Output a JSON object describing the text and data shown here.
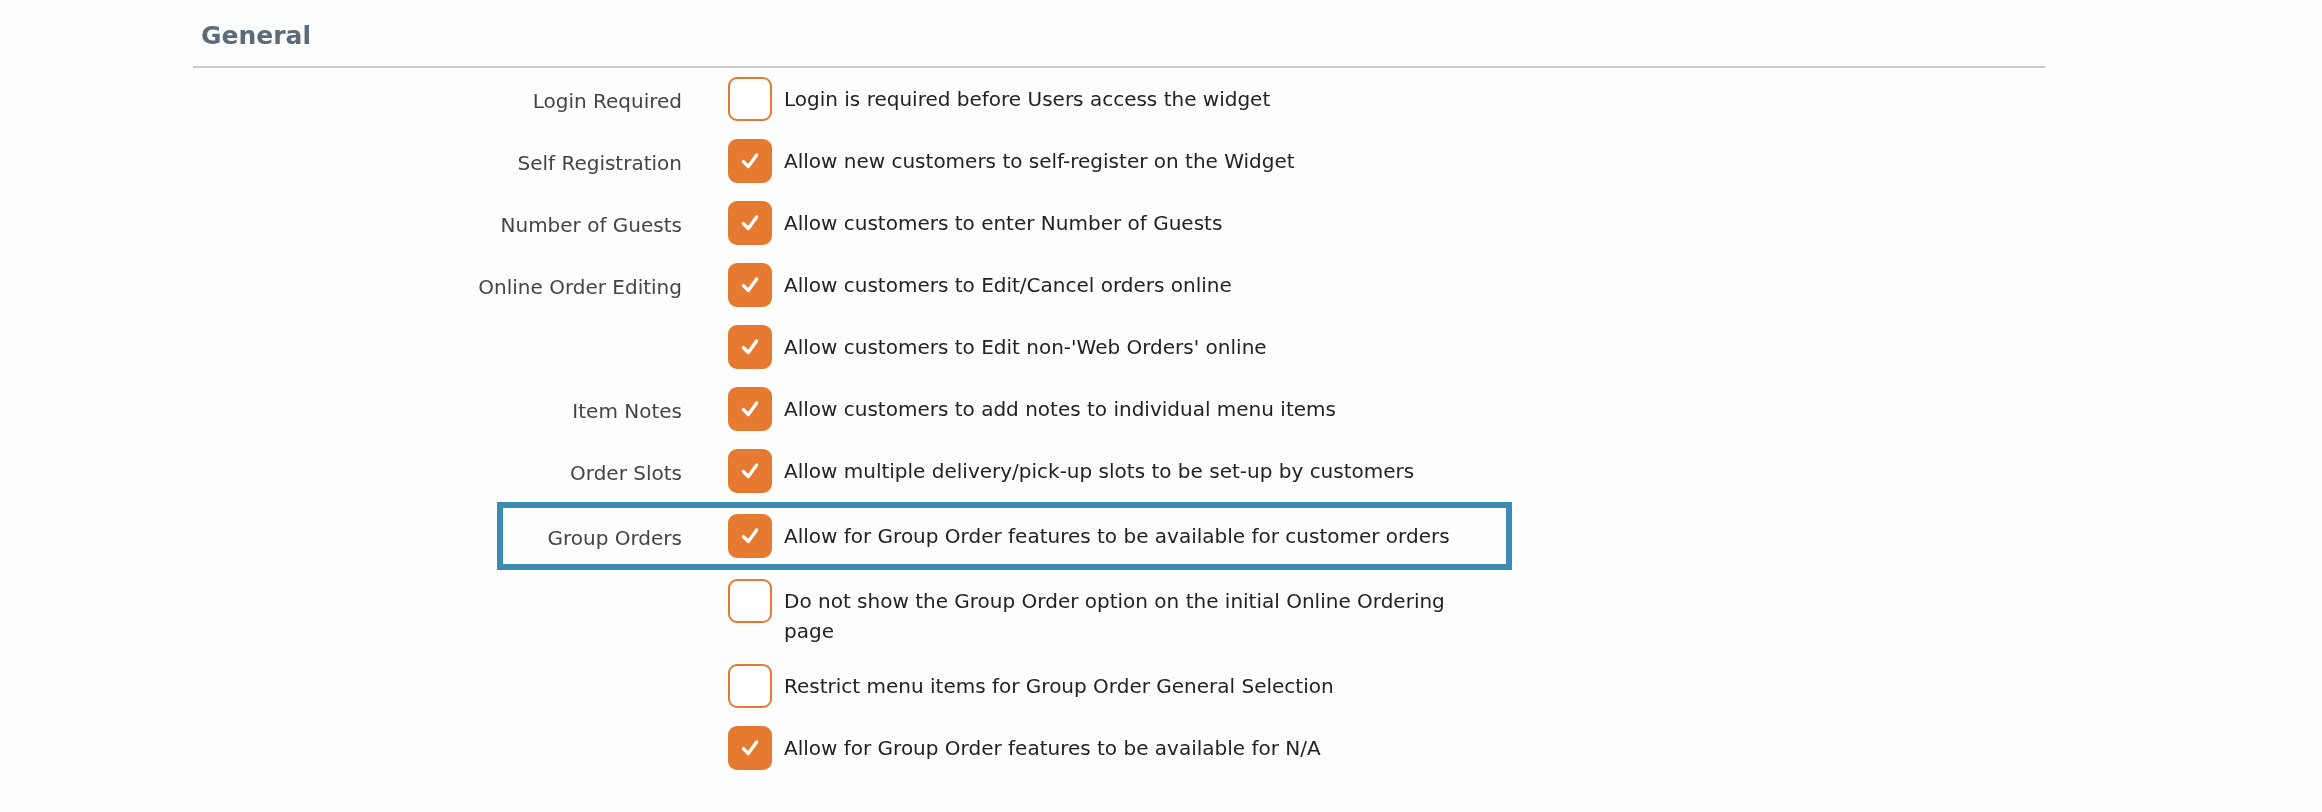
{
  "section": {
    "title": "General"
  },
  "rows": [
    {
      "label": "Login Required",
      "checked": false,
      "text": "Login is required before Users access the widget",
      "highlighted": false
    },
    {
      "label": "Self Registration",
      "checked": true,
      "text": "Allow new customers to self-register on the Widget",
      "highlighted": false
    },
    {
      "label": "Number of Guests",
      "checked": true,
      "text": "Allow customers to enter Number of Guests",
      "highlighted": false
    },
    {
      "label": "Online Order Editing",
      "checked": true,
      "text": "Allow customers to Edit/Cancel orders online",
      "highlighted": false
    },
    {
      "checked": true,
      "text": "Allow customers to Edit non-'Web Orders' online",
      "highlighted": false
    },
    {
      "label": "Item Notes",
      "checked": true,
      "text": "Allow customers to add notes to individual menu items",
      "highlighted": false
    },
    {
      "label": "Order Slots",
      "checked": true,
      "text": "Allow multiple delivery/pick-up slots to be set-up by customers",
      "highlighted": false
    },
    {
      "label": "Group Orders",
      "checked": true,
      "text": "Allow for Group Order features to be available for customer orders",
      "highlighted": true
    },
    {
      "checked": false,
      "text": "Do not show the Group Order option on the initial Online Ordering page",
      "highlighted": false
    },
    {
      "checked": false,
      "text": "Restrict menu items for Group Order General Selection",
      "highlighted": false
    },
    {
      "checked": true,
      "text": "Allow for Group Order features to be available for N/A",
      "highlighted": false
    }
  ]
}
